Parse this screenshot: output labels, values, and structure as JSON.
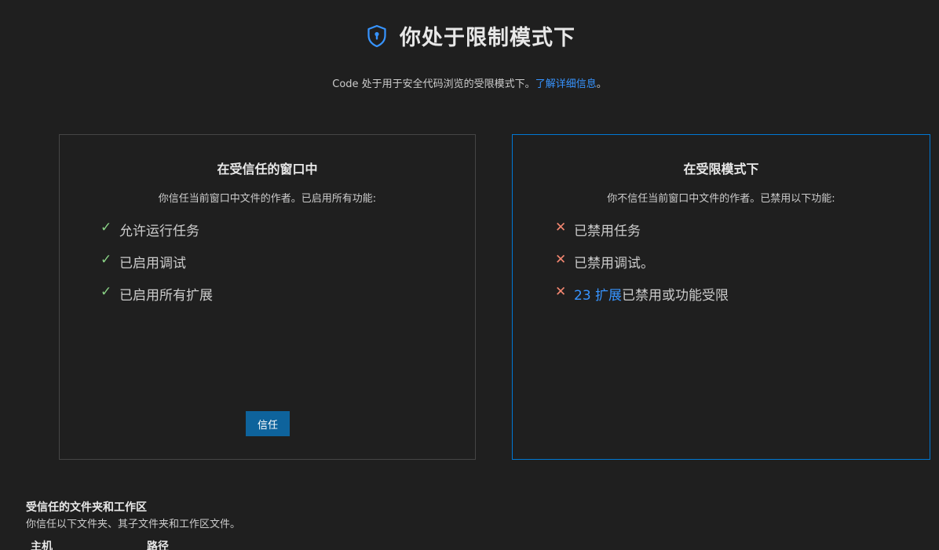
{
  "header": {
    "shield_icon": "shield-icon",
    "title": "你处于限制模式下",
    "subtitle_text": "Code 处于用于安全代码浏览的受限模式下。",
    "learn_more_link": "了解详细信息",
    "subtitle_end": "。"
  },
  "trusted_card": {
    "title": "在受信任的窗口中",
    "description": "你信任当前窗口中文件的作者。已启用所有功能:",
    "features": [
      {
        "icon": "check-icon",
        "text": "允许运行任务"
      },
      {
        "icon": "check-icon",
        "text": "已启用调试"
      },
      {
        "icon": "check-icon",
        "text": "已启用所有扩展"
      }
    ],
    "trust_button_label": "信任"
  },
  "restricted_card": {
    "title": "在受限模式下",
    "description": "你不信任当前窗口中文件的作者。已禁用以下功能:",
    "features": [
      {
        "icon": "cross-icon",
        "text": "已禁用任务"
      },
      {
        "icon": "cross-icon",
        "text": "已禁用调试。"
      }
    ],
    "extensions_link": "23 扩展",
    "extensions_text": "已禁用或功能受限"
  },
  "trusted_folders": {
    "title": "受信任的文件夹和工作区",
    "description": "你信任以下文件夹、其子文件夹和工作区文件。",
    "columns": [
      "主机",
      "路径"
    ]
  },
  "colors": {
    "background": "#1f1f1f",
    "accent_blue": "#0078d4",
    "link": "#3794ff",
    "check": "#89d185",
    "cross": "#f48771",
    "button": "#0e639c"
  }
}
